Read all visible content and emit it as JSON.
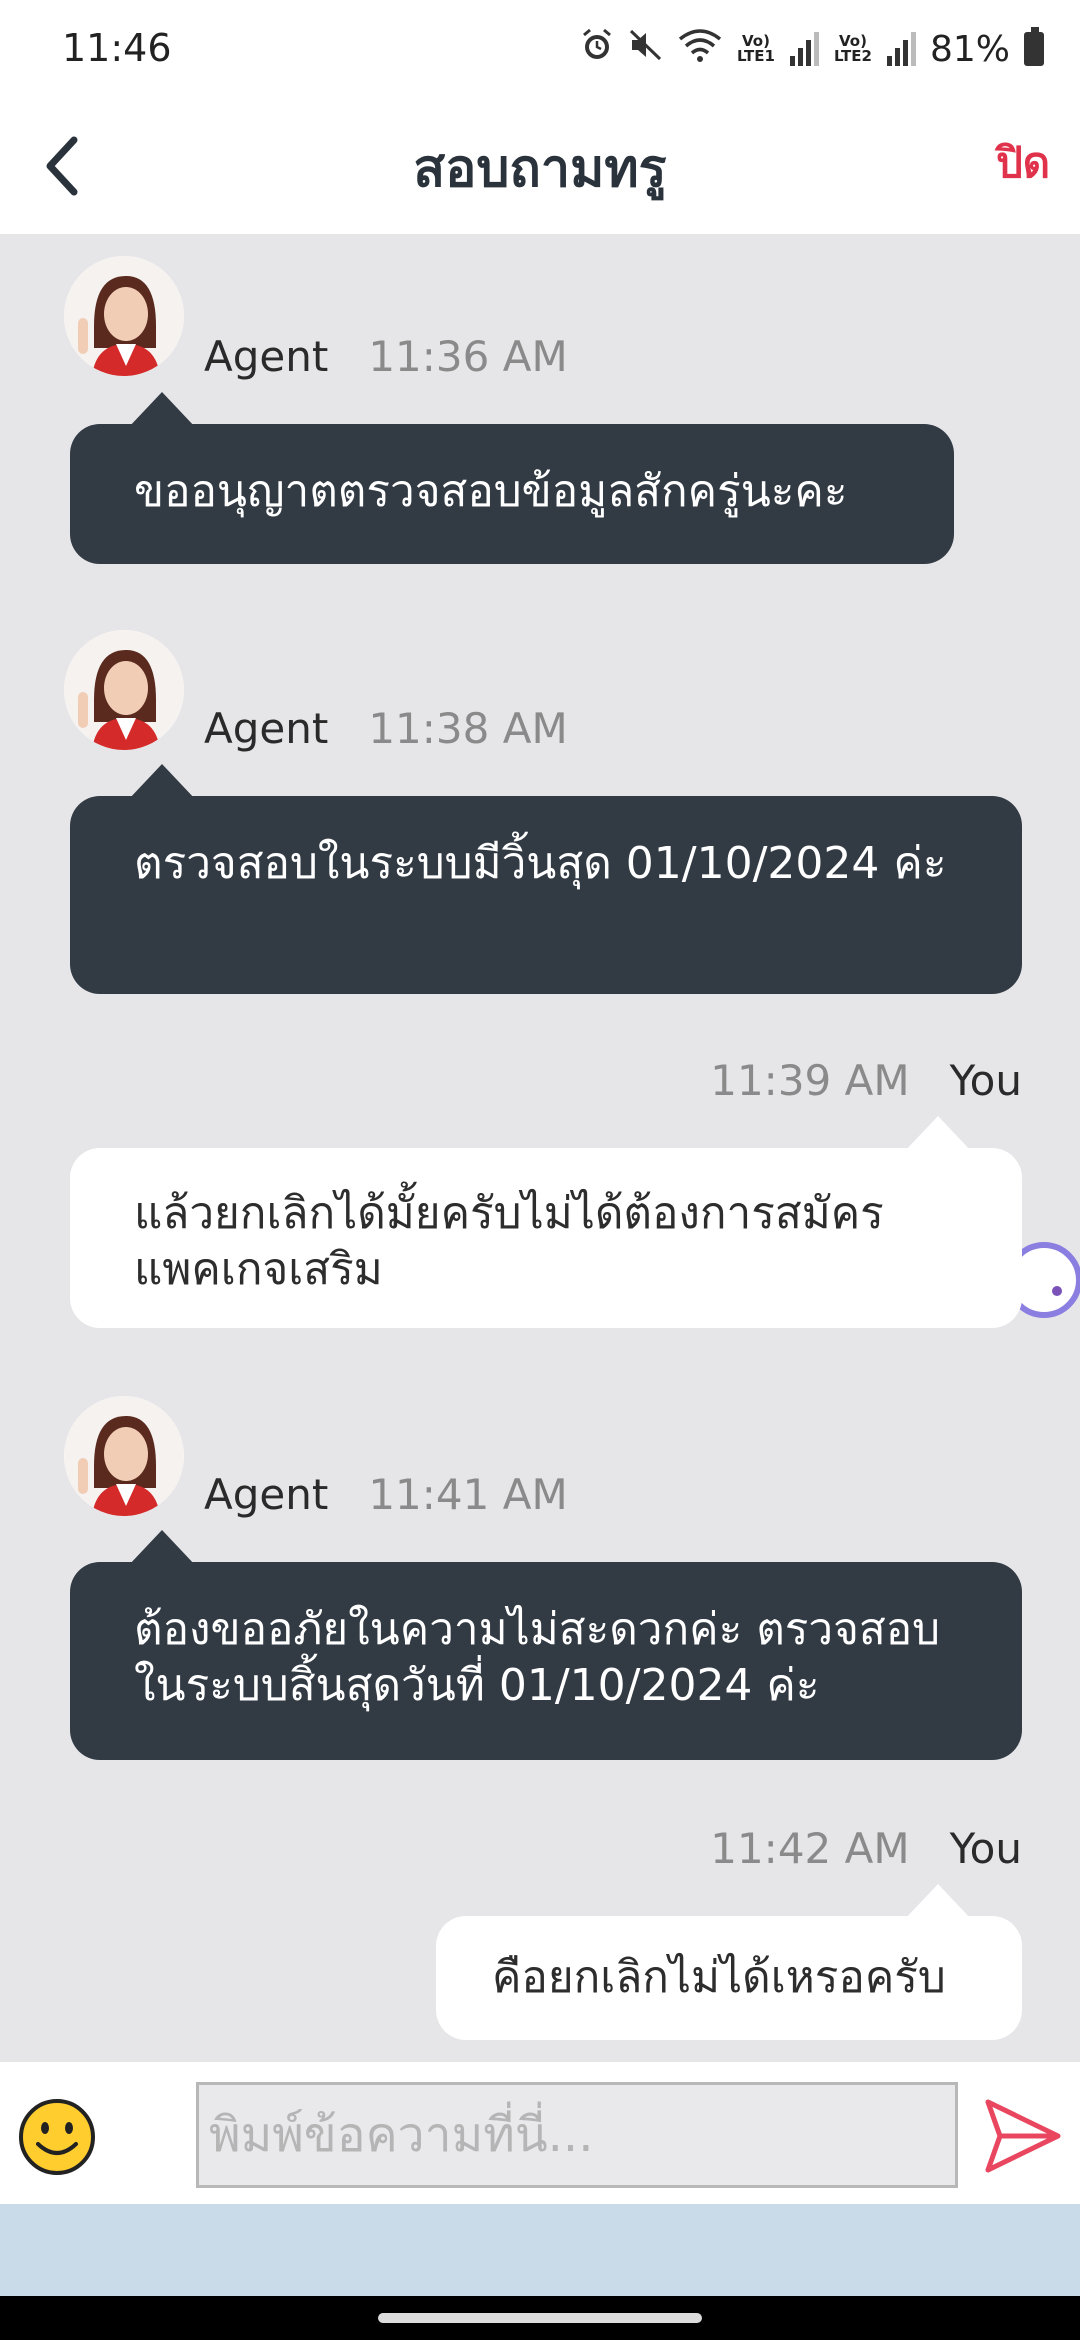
{
  "status_bar": {
    "time": "11:46",
    "battery": "81%",
    "sim1_label": "Vo) LTE1",
    "sim2_label": "Vo) LTE2"
  },
  "header": {
    "title": "สอบถามทรู",
    "close_label": "ปิด"
  },
  "messages": [
    {
      "sender": "Agent",
      "time": "11:36  AM",
      "text": "ขออนุญาตตรวจสอบข้อมูลสักครู่นะคะ"
    },
    {
      "sender": "Agent",
      "time": "11:38  AM",
      "text": "ตรวจสอบในระบบมีวิ้นสุด 01/10/2024 ค่ะ"
    },
    {
      "sender": "You",
      "time": "11:39  AM",
      "text": "แล้วยกเลิกได้มั้ยครับไม่ได้ต้องการสมัคร แพคเกจเสริม"
    },
    {
      "sender": "Agent",
      "time": "11:41  AM",
      "text": "ต้องขออภัยในความไม่สะดวกค่ะ ตรวจสอบในระบบสิ้นสุดวันที่ 01/10/2024 ค่ะ"
    },
    {
      "sender": "You",
      "time": "11:42  AM",
      "text": "คือยกเลิกไม่ได้เหรอครับ"
    }
  ],
  "composer": {
    "placeholder": "พิมพ์ข้อความที่นี่...",
    "value": ""
  },
  "colors": {
    "agent_bubble": "#323a44",
    "user_bubble": "#ffffff",
    "chat_background": "#e6e6e9",
    "close_accent": "#e0324b",
    "send_accent": "#e8475f"
  },
  "icons": {
    "back": "chevron-left-icon",
    "emoji": "smiley-icon",
    "send": "paper-plane-icon"
  }
}
